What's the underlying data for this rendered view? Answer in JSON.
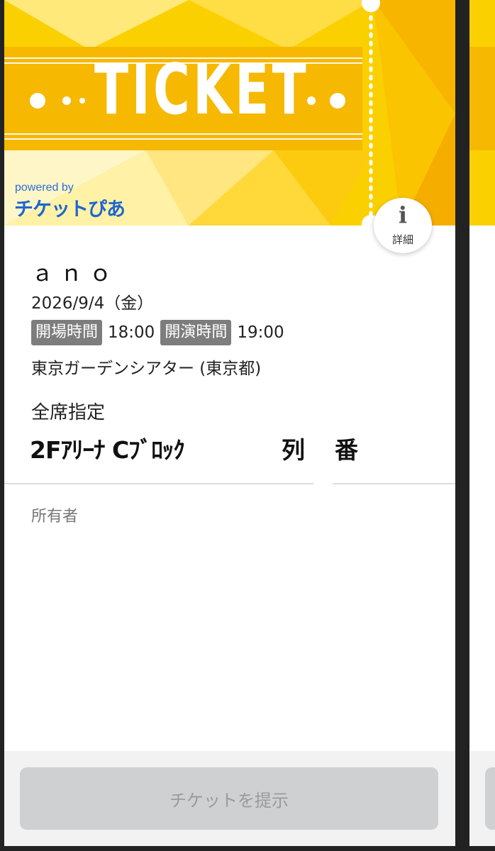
{
  "ticket": {
    "banner_word": "TICKET",
    "powered_by": "powered by",
    "brand": "チケットぴあ",
    "info_icon": "i",
    "info_label": "詳細",
    "artist": "ａｎｏ",
    "date": "2026/9/4（金）",
    "open_label": "開場時間",
    "open_time": "18:00",
    "start_label": "開演時間",
    "start_time": "19:00",
    "venue": "東京ガーデンシアター (東京都)",
    "seat_type": "全席指定",
    "seat_block": "2Fｱﾘｰﾅ Cﾌﾞﾛｯｸ",
    "seat_row": "列",
    "seat_number": "番",
    "owner_label": "所有者",
    "present_button": "チケットを提示"
  },
  "colors": {
    "banner_yellow": "#fbd000",
    "banner_stripe": "#f6b800",
    "brand_blue": "#1e66d0",
    "tag_gray": "#7d7d7d",
    "button_disabled": "#cfd0d2"
  }
}
